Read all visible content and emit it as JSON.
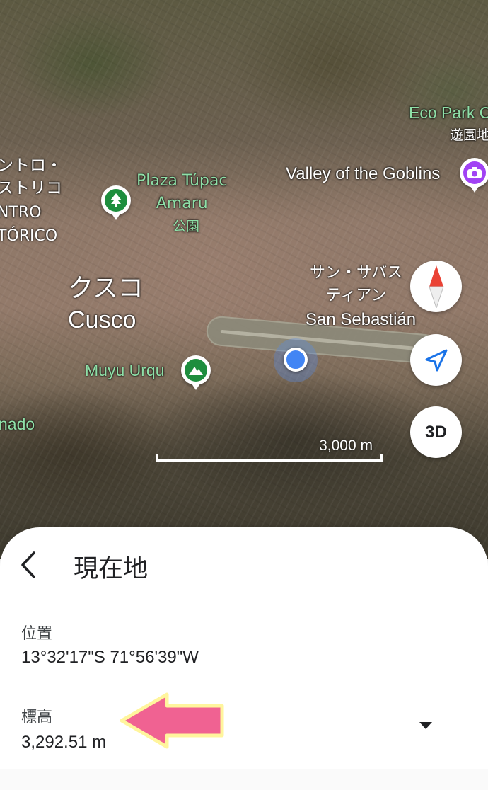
{
  "map": {
    "labels": {
      "centro_jp": "ントロ・\nストリコ",
      "centro_es": "NTRO\nTÓRICO",
      "plaza": "Plaza Túpac\nAmaru",
      "plaza_sub": "公園",
      "cusco_jp": "クスコ",
      "cusco_en": "Cusco",
      "eco_park": "Eco Park C",
      "eco_park_sub": "遊園地",
      "valley": "Valley of the Goblins",
      "san_sebastian_jp": "サン・サバス\nティアン",
      "san_sebastian_es": "San Sebastián",
      "muyu_urqu": "Muyu Urqu",
      "nado": "nado"
    },
    "scale_label": "3,000 m",
    "buttons": {
      "three_d": "3D"
    },
    "colors": {
      "location_blue": "#4285f4",
      "park_green": "#1e8e3e",
      "attraction_purple": "#a142f4",
      "compass_red": "#ea4335"
    }
  },
  "sheet": {
    "title": "現在地",
    "position_label": "位置",
    "position_value": "13°32'17\"S 71°56'39\"W",
    "elevation_label": "標高",
    "elevation_value": "3,292.51 m",
    "annotation_arrow_color": "#f06292"
  }
}
